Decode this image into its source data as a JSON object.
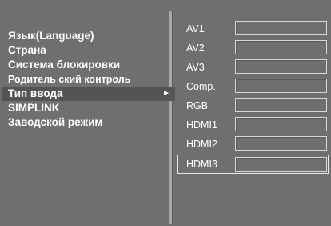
{
  "menu": {
    "items": [
      {
        "label": "Язык(Language)"
      },
      {
        "label": "Страна"
      },
      {
        "label": "Система блокировки"
      },
      {
        "label": "Родитель ский контроль"
      },
      {
        "label": "Тип ввода"
      },
      {
        "label": "SIMPLINK"
      },
      {
        "label": "Заводской режим"
      }
    ],
    "selected_index": 4,
    "selected_arrow": "►"
  },
  "inputs": {
    "items": [
      {
        "label": "AV1"
      },
      {
        "label": "AV2"
      },
      {
        "label": "AV3"
      },
      {
        "label": "Comp."
      },
      {
        "label": "RGB"
      },
      {
        "label": "HDMI1"
      },
      {
        "label": "HDMI2"
      },
      {
        "label": "HDMI3"
      }
    ],
    "selected_index": 7
  },
  "colors": {
    "background": "#6f6f6f",
    "selected_row": "#545454",
    "text": "#ffffff"
  }
}
